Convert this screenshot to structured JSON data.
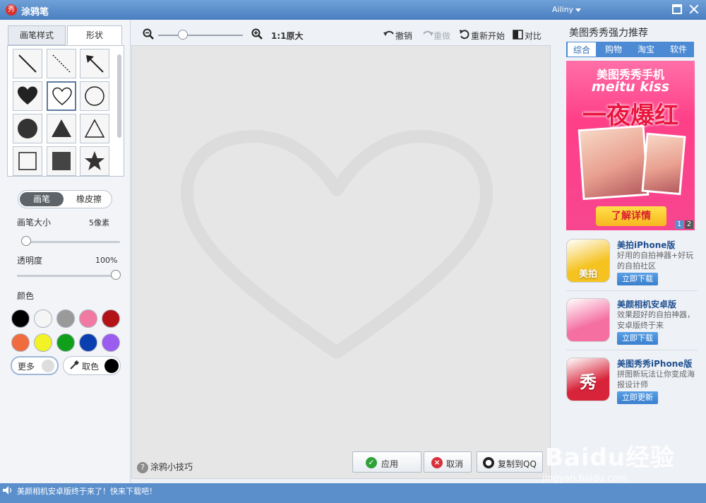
{
  "window": {
    "title": "涂鸦笔",
    "user": "Ailiny"
  },
  "left": {
    "tabs": [
      {
        "label": "画笔样式"
      },
      {
        "label": "形状"
      }
    ],
    "shapes": [
      {
        "name": "line"
      },
      {
        "name": "dashed-line"
      },
      {
        "name": "arrow"
      },
      {
        "name": "heart-filled"
      },
      {
        "name": "heart-outline"
      },
      {
        "name": "circle-outline"
      },
      {
        "name": "circle-filled"
      },
      {
        "name": "triangle-filled"
      },
      {
        "name": "triangle-outline"
      },
      {
        "name": "square-outline"
      },
      {
        "name": "square-filled"
      },
      {
        "name": "star-filled"
      }
    ],
    "selected_shape": "heart-outline",
    "mode": {
      "brush": "画笔",
      "eraser": "橡皮擦"
    },
    "brush_size": {
      "label": "画笔大小",
      "value": "5像素",
      "level": 0.05
    },
    "opacity": {
      "label": "透明度",
      "value": "100%",
      "level": 1.0
    },
    "color_label": "颜色",
    "colors": [
      "#000000",
      "#f5f5f5",
      "#9a9a9a",
      "#f07aa2",
      "#b31217",
      "#f06b3e",
      "#f2f227",
      "#0f9f1b",
      "#0a3fb0",
      "#9b5cf0"
    ],
    "more_label": "更多",
    "picker_label": "取色"
  },
  "toolbar": {
    "zoom_label": "1:1原大",
    "undo": "撤销",
    "redo": "重做",
    "restart": "重新开始",
    "compare": "对比"
  },
  "canvas": {
    "tips": "涂鸦小技巧"
  },
  "actions": {
    "apply": "应用",
    "cancel": "取消",
    "copy_qq": "复制到QQ"
  },
  "right": {
    "title": "美图秀秀强力推荐",
    "tabs": [
      {
        "label": "综合"
      },
      {
        "label": "购物"
      },
      {
        "label": "淘宝"
      },
      {
        "label": "软件"
      }
    ],
    "banner": {
      "line1": "美图秀秀手机",
      "line2": "meitu kiss",
      "line3": "一夜爆红",
      "cta": "了解详情",
      "pages": [
        "1",
        "2"
      ]
    },
    "apps": [
      {
        "name": "美拍iPhone版",
        "desc": "好用的自拍神器+好玩的自拍社区",
        "button": "立即下载",
        "icon_text": "美拍",
        "color": "#f5c21f"
      },
      {
        "name": "美颜相机安卓版",
        "desc": "效果超好的自拍神器，安卓版终于来",
        "button": "立即下载",
        "icon_text": "",
        "color": "#f56fa1"
      },
      {
        "name": "美图秀秀iPhone版",
        "desc": "拼图新玩法让你变成海报设计师",
        "button": "立即更新",
        "icon_text": "秀",
        "color": "#d8243a"
      }
    ]
  },
  "status": {
    "text": "美颜相机安卓版终于来了！快来下载吧！"
  },
  "watermark": {
    "logo": "Baidu经验",
    "url": "jingyan.baidu.com"
  }
}
